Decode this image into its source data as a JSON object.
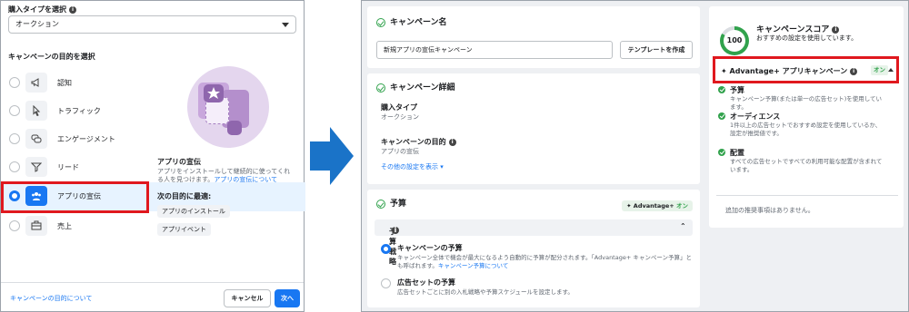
{
  "left": {
    "purchase_label": "購入タイプを選択",
    "purchase_value": "オークション",
    "objective_label": "キャンペーンの目的を選択",
    "objectives": [
      {
        "label": "認知"
      },
      {
        "label": "トラフィック"
      },
      {
        "label": "エンゲージメント"
      },
      {
        "label": "リード"
      },
      {
        "label": "アプリの宣伝"
      },
      {
        "label": "売上"
      }
    ],
    "info_title": "アプリの宣伝",
    "info_desc": "アプリをインストールして継続的に使ってくれる人を見つけます。",
    "info_link": "アプリの宣伝について",
    "best_for": "次の目的に最適:",
    "chips": [
      "アプリのインストール",
      "アプリイベント"
    ],
    "about_link": "キャンペーンの目的について",
    "cancel": "キャンセル",
    "next": "次へ"
  },
  "campaign": {
    "title": "キャンペーン名",
    "name_value": "新規アプリの宣伝キャンペーン",
    "template_btn": "テンプレートを作成"
  },
  "details": {
    "title": "キャンペーン詳細",
    "purchase_label": "購入タイプ",
    "purchase_value": "オークション",
    "objective_label": "キャンペーンの目的",
    "objective_value": "アプリの宣伝",
    "more_settings": "その他の設定を表示 ▾"
  },
  "budget": {
    "title": "予算",
    "badge": "Advantage+",
    "badge_on": "オン",
    "strategy_label": "予算戦略",
    "options": [
      {
        "title": "キャンペーンの予算",
        "desc": "キャンペーン全体で機会が最大になるよう自動的に予算が配分されます。「Advantage+ キャンペーン予算」とも呼ばれます。",
        "link": "キャンペーン予算について"
      },
      {
        "title": "広告セットの予算",
        "desc": "広告セットごとに別の入札戦略や予算スケジュールを設定します。",
        "link": ""
      }
    ]
  },
  "score": {
    "value": "100",
    "fraction": 1.0,
    "title": "キャンペーンスコア",
    "subtitle": "おすすめの設定を使用しています。",
    "adv_label": "Advantage+ アプリキャンペーン",
    "adv_on": "オン",
    "items": [
      {
        "title": "予算",
        "desc": "キャンペーン予算(または単一の広告セット)を使用しています。"
      },
      {
        "title": "オーディエンス",
        "desc": "1件以上の広告セットでおすすめ設定を使用しているか、設定が推奨値です。"
      },
      {
        "title": "配置",
        "desc": "すべての広告セットですべての利用可能な配置が含まれています。"
      }
    ],
    "no_rec": "追加の推奨事項はありません。"
  },
  "colors": {
    "accent": "#1877f2",
    "highlight": "#e0181e",
    "success": "#31a24c",
    "arrow": "#1a73c8"
  }
}
